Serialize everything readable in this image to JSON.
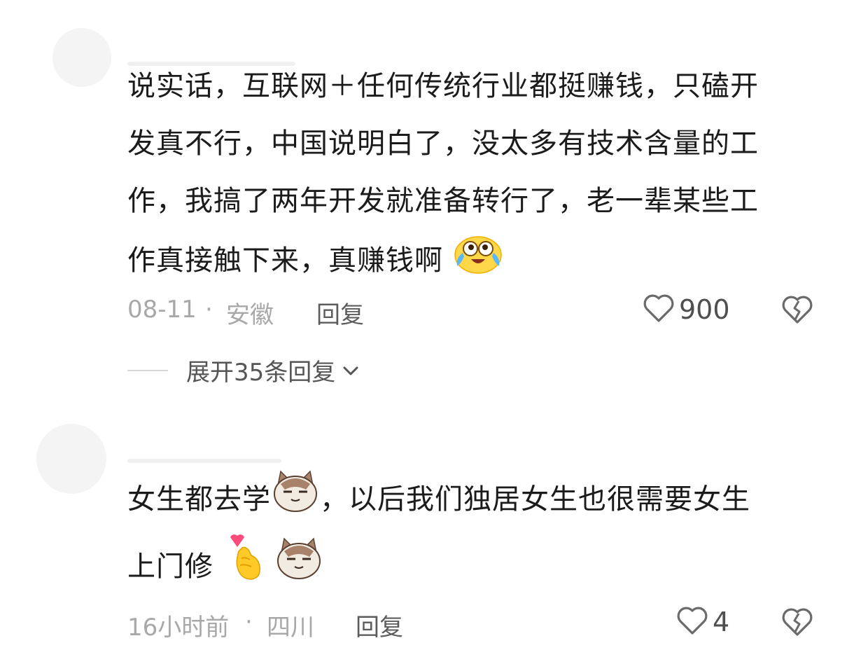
{
  "comments": [
    {
      "lines": [
        "说实话，互联网＋任何传统行业都挺赚钱，只磕开",
        "发真不行，中国说明白了，没太多有技术含量的工",
        "作，我搞了两年开发就准备转行了，老一辈某些工",
        "作真接触下来，真赚钱啊"
      ],
      "emoji": "crying-laughing-emoji",
      "date": "08-11",
      "separator": "·",
      "location": "安徽",
      "reply_label": "回复",
      "likes": "900"
    },
    {
      "line1_before": "女生都去学",
      "line1_after": "，以后我们独居女生也很需要女生",
      "line2": "上门修",
      "emojis": [
        "smug-cat-emoji",
        "finger-heart-emoji",
        "smug-cat-emoji"
      ],
      "date": "16小时前",
      "separator": "·",
      "location": "四川",
      "reply_label": "回复",
      "likes": "4"
    }
  ],
  "expand_replies": {
    "label": "展开35条回复"
  },
  "icons": [
    "heart-outline-icon",
    "broken-heart-icon",
    "chevron-down-icon"
  ],
  "colors": {
    "text": "#1b1b1b",
    "meta": "#a8a8a8",
    "reply": "#5c5c5c",
    "icon": "#6a6a6a"
  }
}
